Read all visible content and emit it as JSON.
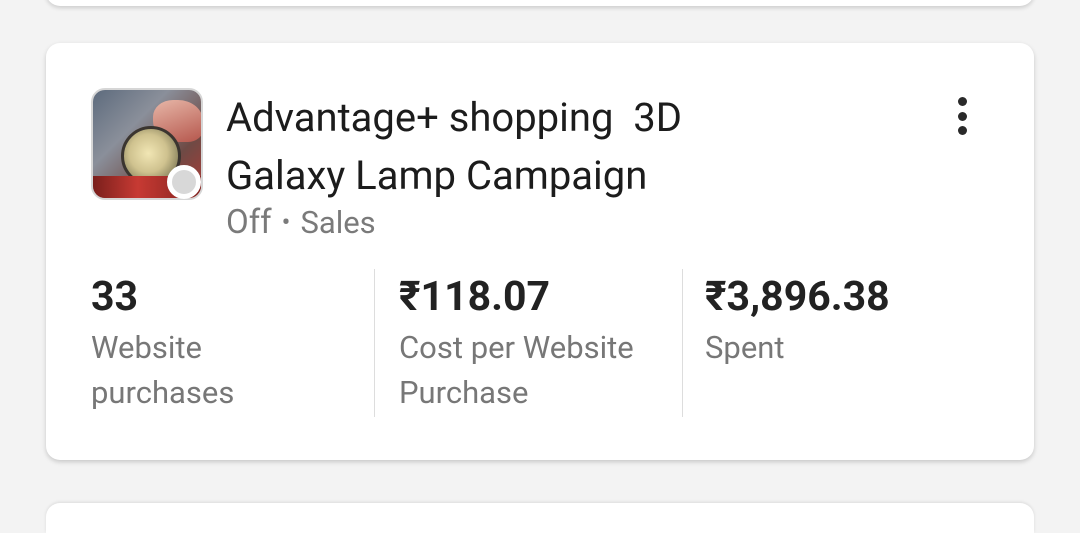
{
  "campaign": {
    "title": "Advantage+ shopping  3D Galaxy Lamp Campaign",
    "status": "Off",
    "separator": "•",
    "objective": "Sales",
    "thumbnail_icon": "product-thumbnail",
    "status_dot_color": "#d8d8d8",
    "more_icon": "more-vertical-icon"
  },
  "metrics": [
    {
      "value": "33",
      "label": "Website\npurchases"
    },
    {
      "value": "₹118.07",
      "label": "Cost per Website\nPurchase"
    },
    {
      "value": "₹3,896.38",
      "label": "Spent"
    }
  ]
}
